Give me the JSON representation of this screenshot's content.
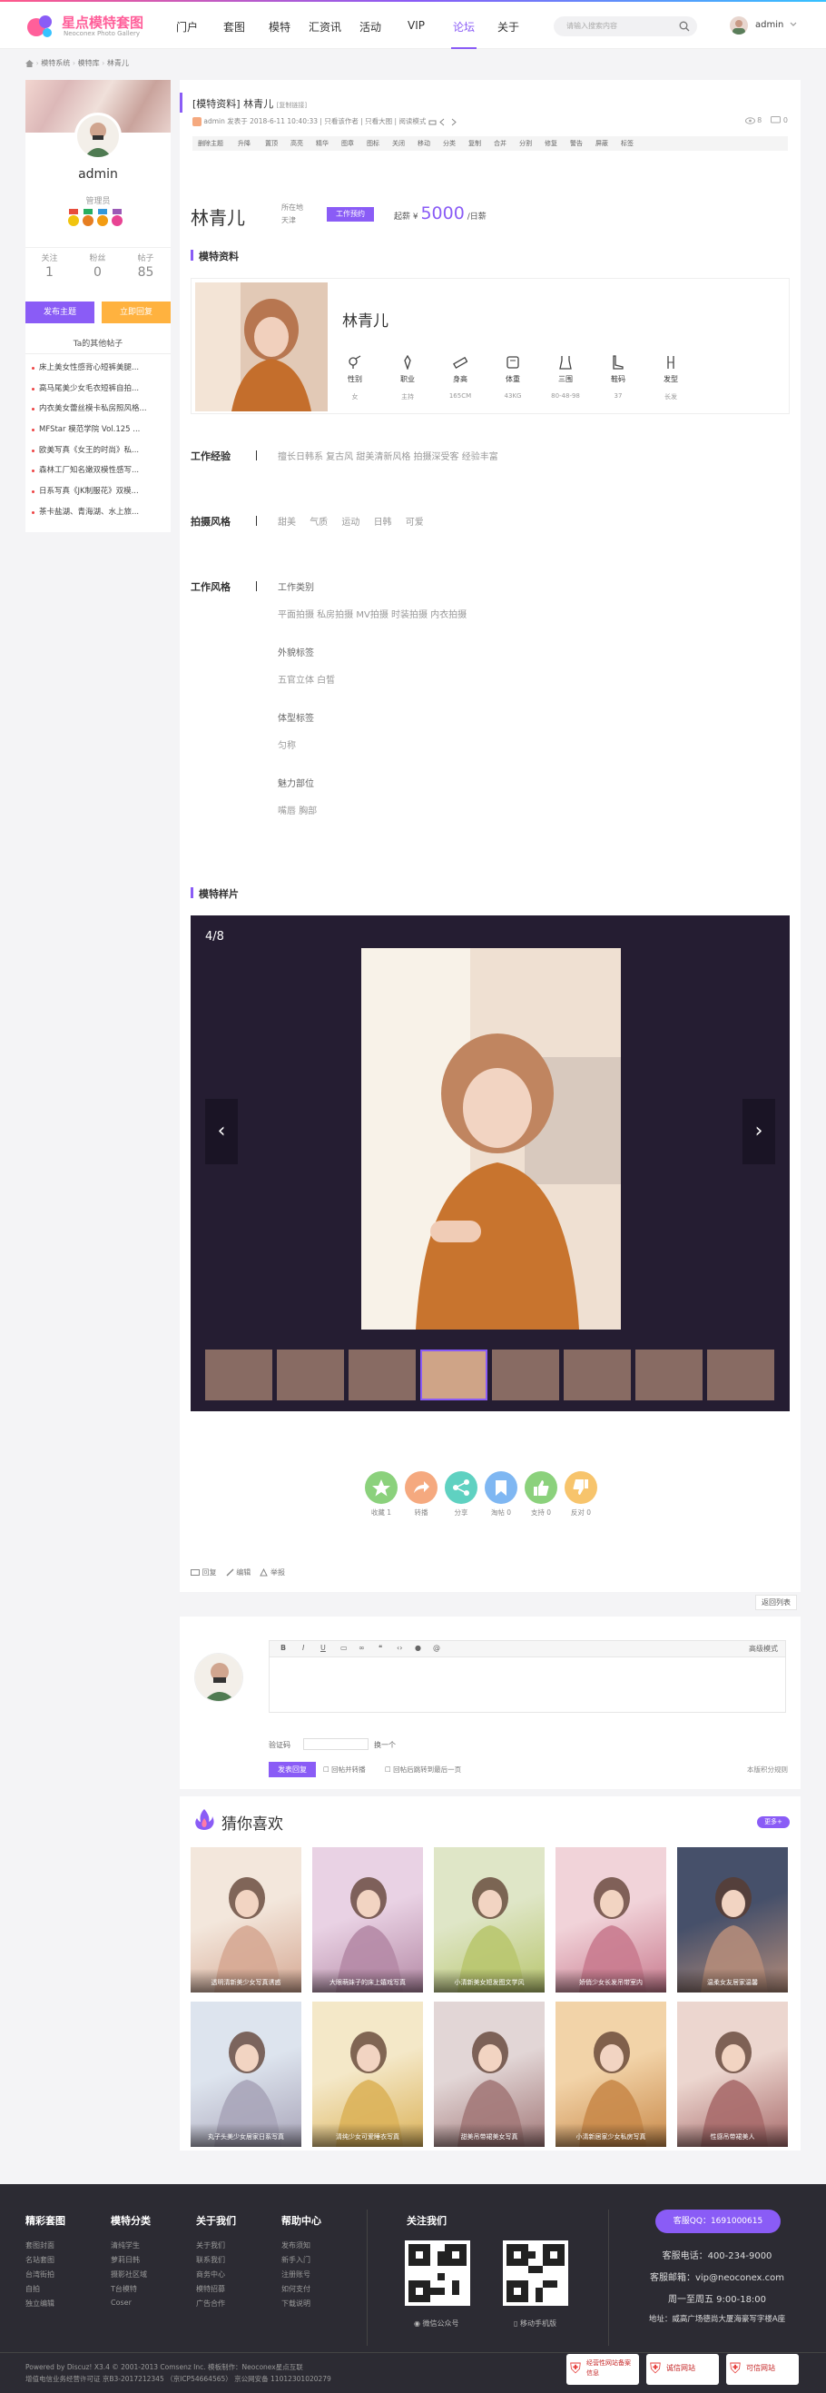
{
  "header": {
    "logo_main": "星点模特套图",
    "logo_sub": "Neoconex Photo Gallery",
    "nav": [
      "门户",
      "套图",
      "模特",
      "汇资讯",
      "活动",
      "VIP",
      "论坛",
      "关于"
    ],
    "active_nav": "论坛",
    "search_placeholder": "请输入搜索内容",
    "username": "admin"
  },
  "breadcrumb": [
    "模特系统",
    "模特库",
    "林青儿"
  ],
  "sidebar": {
    "name": "admin",
    "role": "管理员",
    "stats": [
      {
        "label": "关注",
        "value": "1"
      },
      {
        "label": "粉丝",
        "value": "0"
      },
      {
        "label": "帖子",
        "value": "85"
      }
    ],
    "post_button": "发布主题",
    "fav_button": "立即回复",
    "other_title": "Ta的其他帖子",
    "other_posts": [
      "床上美女性感背心短裤美腿...",
      "高马尾美少女毛衣短裤自拍...",
      "内衣美女蕾丝模卡私房照风格...",
      "MFStar 模范学院 Vol.125 ...",
      "欧美写真《女王的时尚》私...",
      "森林工厂知名嫩双模性感写...",
      "日系写真《JK制服花》双模...",
      "茶卡盐湖、青海湖、水上旅..."
    ]
  },
  "post": {
    "title": "[模特资料] 林青儿",
    "title_suffix": "[复制链接]",
    "meta": "admin 发表于 2018-6-11 10:40:33  |  只看该作者  |  只看大图  |  阅读模式",
    "views": "8",
    "replies": "0",
    "tags": [
      "删除主题",
      "升降",
      "置顶",
      "高亮",
      "精华",
      "图章",
      "图标",
      "关闭",
      "移动",
      "分类",
      "复制",
      "合并",
      "分割",
      "修复",
      "警告",
      "屏蔽",
      "标签"
    ]
  },
  "model": {
    "name": "林青儿",
    "location_label": "所在地",
    "location": "天津",
    "status": "工作预约",
    "price_prefix": "起薪 ¥",
    "price": "5000",
    "price_unit": "/日薪",
    "section_info": "模特资料",
    "attrs": [
      {
        "icon": "gender-icon",
        "name": "性别",
        "value": "女"
      },
      {
        "icon": "job-icon",
        "name": "职业",
        "value": "主持"
      },
      {
        "icon": "height-icon",
        "name": "身高",
        "value": "165CM"
      },
      {
        "icon": "weight-icon",
        "name": "体重",
        "value": "43KG"
      },
      {
        "icon": "bust-icon",
        "name": "三围",
        "value": "80-48-98"
      },
      {
        "icon": "shoe-icon",
        "name": "鞋码",
        "value": "37"
      },
      {
        "icon": "hair-icon",
        "name": "发型",
        "value": "长发"
      }
    ],
    "experience_label": "工作经验",
    "experience": "擅长日韩系 复古风 甜美清新风格 拍摄深受客 经验丰富",
    "shoot_label": "拍摄风格",
    "shoot_styles": [
      "甜美",
      "气质",
      "运动",
      "日韩",
      "可爱"
    ],
    "work_label": "工作风格",
    "work_type_title": "工作类别",
    "work_types": "平面拍摄 私房拍摄 MV拍摄 时装拍摄 内衣拍摄",
    "look_title": "外貌标签",
    "look_tags": "五官立体    白皙",
    "body_title": "体型标签",
    "body_tags": "匀称",
    "charm_title": "魅力部位",
    "charm_tags": "嘴唇    胸部",
    "section_gallery": "模特样片",
    "gallery_counter": "4/8",
    "gallery_active": 4,
    "gallery_total": 8
  },
  "actions": [
    {
      "label": "收藏 1",
      "color": "#8bd17c",
      "icon": "star-icon"
    },
    {
      "label": "转播",
      "color": "#f5a97f",
      "icon": "share-icon"
    },
    {
      "label": "分享",
      "color": "#5fd1c1",
      "icon": "network-icon"
    },
    {
      "label": "淘帖 0",
      "color": "#7fb7f2",
      "icon": "bookmark-icon"
    },
    {
      "label": "支持 0",
      "color": "#8bd17c",
      "icon": "thumbs-up-icon"
    },
    {
      "label": "反对 0",
      "color": "#f7c46c",
      "icon": "thumbs-down-icon"
    }
  ],
  "post_footer": {
    "reply": "回复",
    "edit": "编辑",
    "report": "举报",
    "back_top": "返回列表"
  },
  "reply_box": {
    "advanced": "高级模式",
    "verify_label": "验证码",
    "refresh": "换一个",
    "submit": "发表回复",
    "option1": "回帖并转播",
    "option2": "回帖后跳转到最后一页",
    "rules": "本版积分规则"
  },
  "guess": {
    "title": "猜你喜欢",
    "more": "更多+",
    "items": [
      {
        "caption": "透明清新美少女写真诱惑"
      },
      {
        "caption": "大眼萌妹子的床上嬉戏写真"
      },
      {
        "caption": "小清新美女短发图文学风"
      },
      {
        "caption": "娇俏少女长发吊带室内"
      },
      {
        "caption": "温柔女友居家温馨"
      },
      {
        "caption": "丸子头美少女居家日系写真"
      },
      {
        "caption": "清纯少女可爱睡衣写真"
      },
      {
        "caption": "甜美吊带裙美女写真"
      },
      {
        "caption": "小清新居家少女私房写真"
      },
      {
        "caption": "性感吊带裙美人"
      }
    ]
  },
  "footer": {
    "cols": [
      {
        "title": "精彩套图",
        "items": [
          "套图封面",
          "名站套图",
          "台湾街拍",
          "自拍",
          "独立编辑"
        ]
      },
      {
        "title": "模特分类",
        "items": [
          "清纯学生",
          "萝莉日韩",
          "摄影社区域",
          "T台模特",
          "Coser"
        ]
      },
      {
        "title": "关于我们",
        "items": [
          "关于我们",
          "联系我们",
          "商务中心",
          "模特招募",
          "广告合作"
        ]
      },
      {
        "title": "帮助中心",
        "items": [
          "发布须知",
          "新手入门",
          "注册账号",
          "如何支付",
          "下载说明"
        ]
      }
    ],
    "follow_title": "关注我们",
    "qr1_caption": "微信公众号",
    "qr2_caption": "移动手机版",
    "qq": "客服QQ：1691000615",
    "phone": "客服电话：400-234-9000",
    "email": "客服邮箱：vip@neoconex.com",
    "hours": "周一至周五 9:00-18:00",
    "address": "地址：威高广场德尚大厦海豪写字楼A座",
    "copy1": "Powered by Discuz!  X3.4 © 2001-2013 Comsenz Inc.  模板制作：Neoconex星点互联",
    "copy2": "增值电信业务经营许可证 京B3-2017212345  （京ICP54664565）  京公网安备 11012301020279",
    "seals": [
      "经营性网站备案信息",
      "诚信网站",
      "可信网站"
    ]
  },
  "colors": {
    "accent": "#8a5cf6",
    "orange": "#ffb23f",
    "dark": "#2c2b33"
  }
}
